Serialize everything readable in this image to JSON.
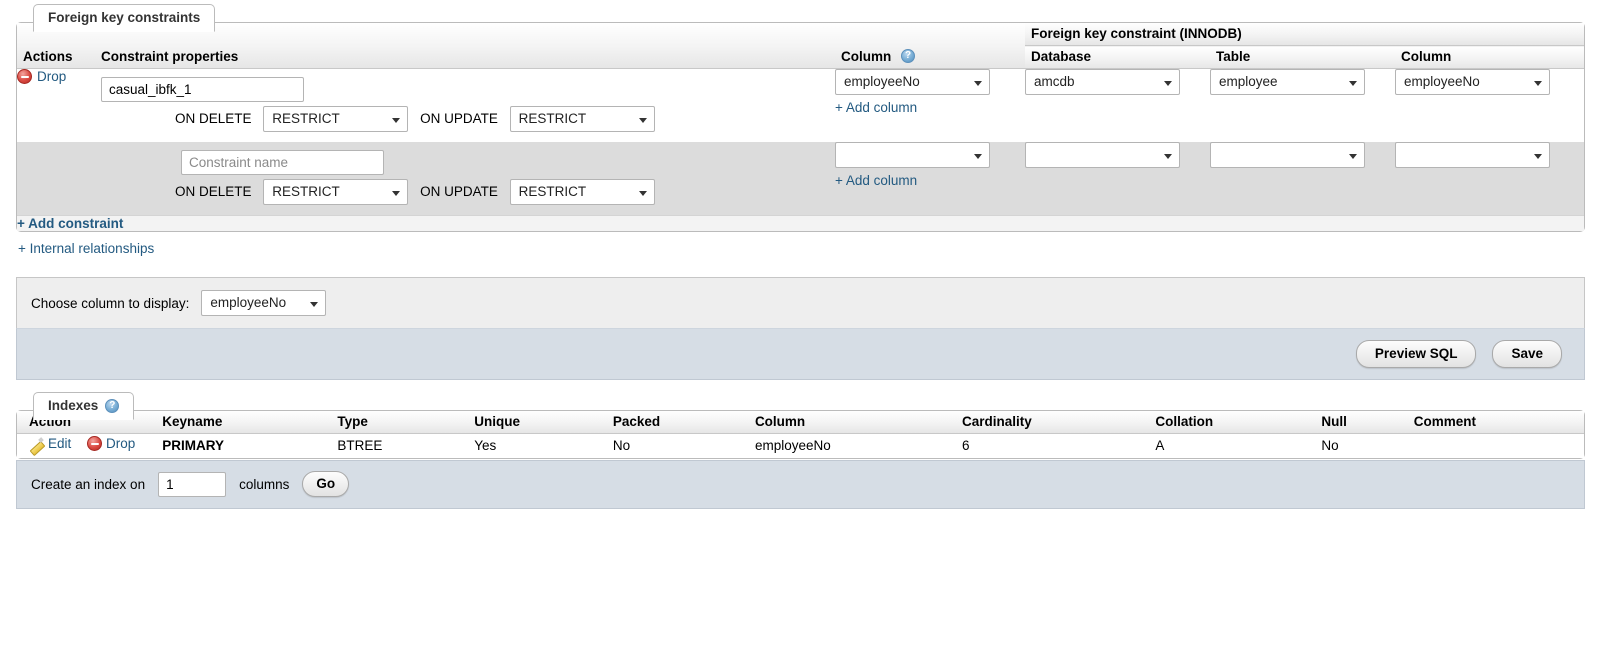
{
  "fk_section": {
    "legend": "Foreign key constraints",
    "headers": {
      "actions": "Actions",
      "constraint_properties": "Constraint properties",
      "column": "Column",
      "column_help_icon": "help-icon",
      "foreign_key_constraint": "Foreign key constraint (INNODB)",
      "sub_database": "Database",
      "sub_table": "Table",
      "sub_column": "Column"
    },
    "rows": [
      {
        "action_label": "Drop",
        "action_icon": "drop-icon",
        "constraint_name_value": "casual_ibfk_1",
        "constraint_name_placeholder": "",
        "on_delete_label": "ON DELETE",
        "on_delete_value": "RESTRICT",
        "on_update_label": "ON UPDATE",
        "on_update_value": "RESTRICT",
        "column_value": "employeeNo",
        "add_column_label": "+ Add column",
        "fk_database": "amcdb",
        "fk_table": "employee",
        "fk_column": "employeeNo"
      },
      {
        "action_label": "",
        "action_icon": "",
        "constraint_name_value": "",
        "constraint_name_placeholder": "Constraint name",
        "on_delete_label": "ON DELETE",
        "on_delete_value": "RESTRICT",
        "on_update_label": "ON UPDATE",
        "on_update_value": "RESTRICT",
        "column_value": "",
        "add_column_label": "+ Add column",
        "fk_database": "",
        "fk_table": "",
        "fk_column": ""
      }
    ],
    "add_constraint_label": "+ Add constraint",
    "internal_relationships_label": "+ Internal relationships"
  },
  "choose_column": {
    "label": "Choose column to display:",
    "value": "employeeNo"
  },
  "form_actions": {
    "preview_sql_label": "Preview SQL",
    "save_label": "Save"
  },
  "indexes_section": {
    "legend": "Indexes",
    "legend_help_icon": "help-icon",
    "headers": [
      "Action",
      "Keyname",
      "Type",
      "Unique",
      "Packed",
      "Column",
      "Cardinality",
      "Collation",
      "Null",
      "Comment"
    ],
    "rows": [
      {
        "edit_label": "Edit",
        "edit_icon": "pencil-icon",
        "drop_label": "Drop",
        "drop_icon": "drop-icon",
        "keyname": "PRIMARY",
        "type": "BTREE",
        "unique": "Yes",
        "packed": "No",
        "column": "employeeNo",
        "cardinality": "6",
        "collation": "A",
        "null": "No",
        "comment": ""
      }
    ],
    "create_index": {
      "prefix_label": "Create an index on",
      "count_value": "1",
      "suffix_label": "columns",
      "go_label": "Go"
    }
  },
  "colors": {
    "link": "#235a81",
    "footer_bar": "#d6dde5",
    "row_alt": "#dcdcdc",
    "drop_icon_red": "#da4a42",
    "help_icon_blue": "#4f8cbd"
  }
}
